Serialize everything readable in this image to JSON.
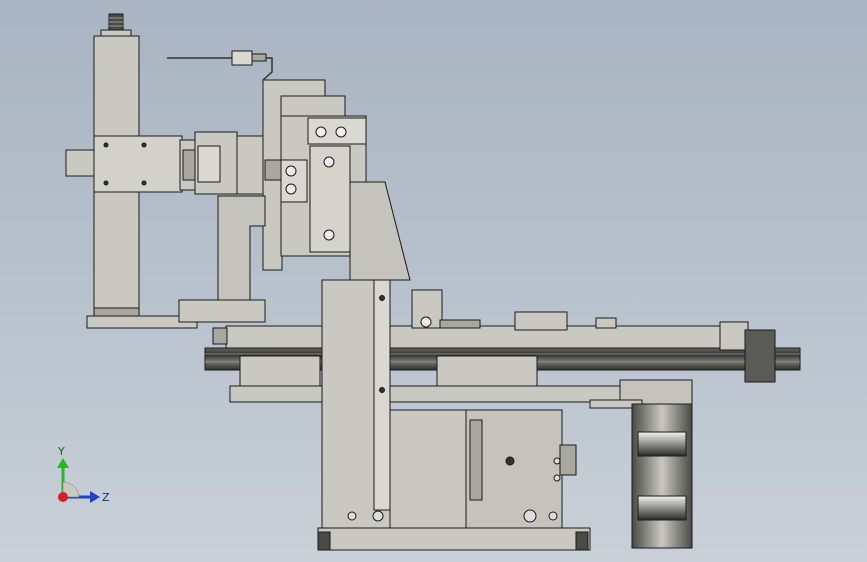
{
  "viewport": {
    "background_top": "#a9b4c2",
    "background_bottom": "#c9d0d8",
    "part_fill": "#c9c9c2",
    "part_fill_light": "#d9d9d2",
    "part_fill_dark": "#a8a8a0",
    "edge_color": "#1a1a1a",
    "rail_color": "#4a4a4a"
  },
  "triad": {
    "y_label": "Y",
    "z_label": "Z",
    "y_color": "#2bb52b",
    "z_color": "#1f3fd6",
    "x_color": "#d42020"
  }
}
